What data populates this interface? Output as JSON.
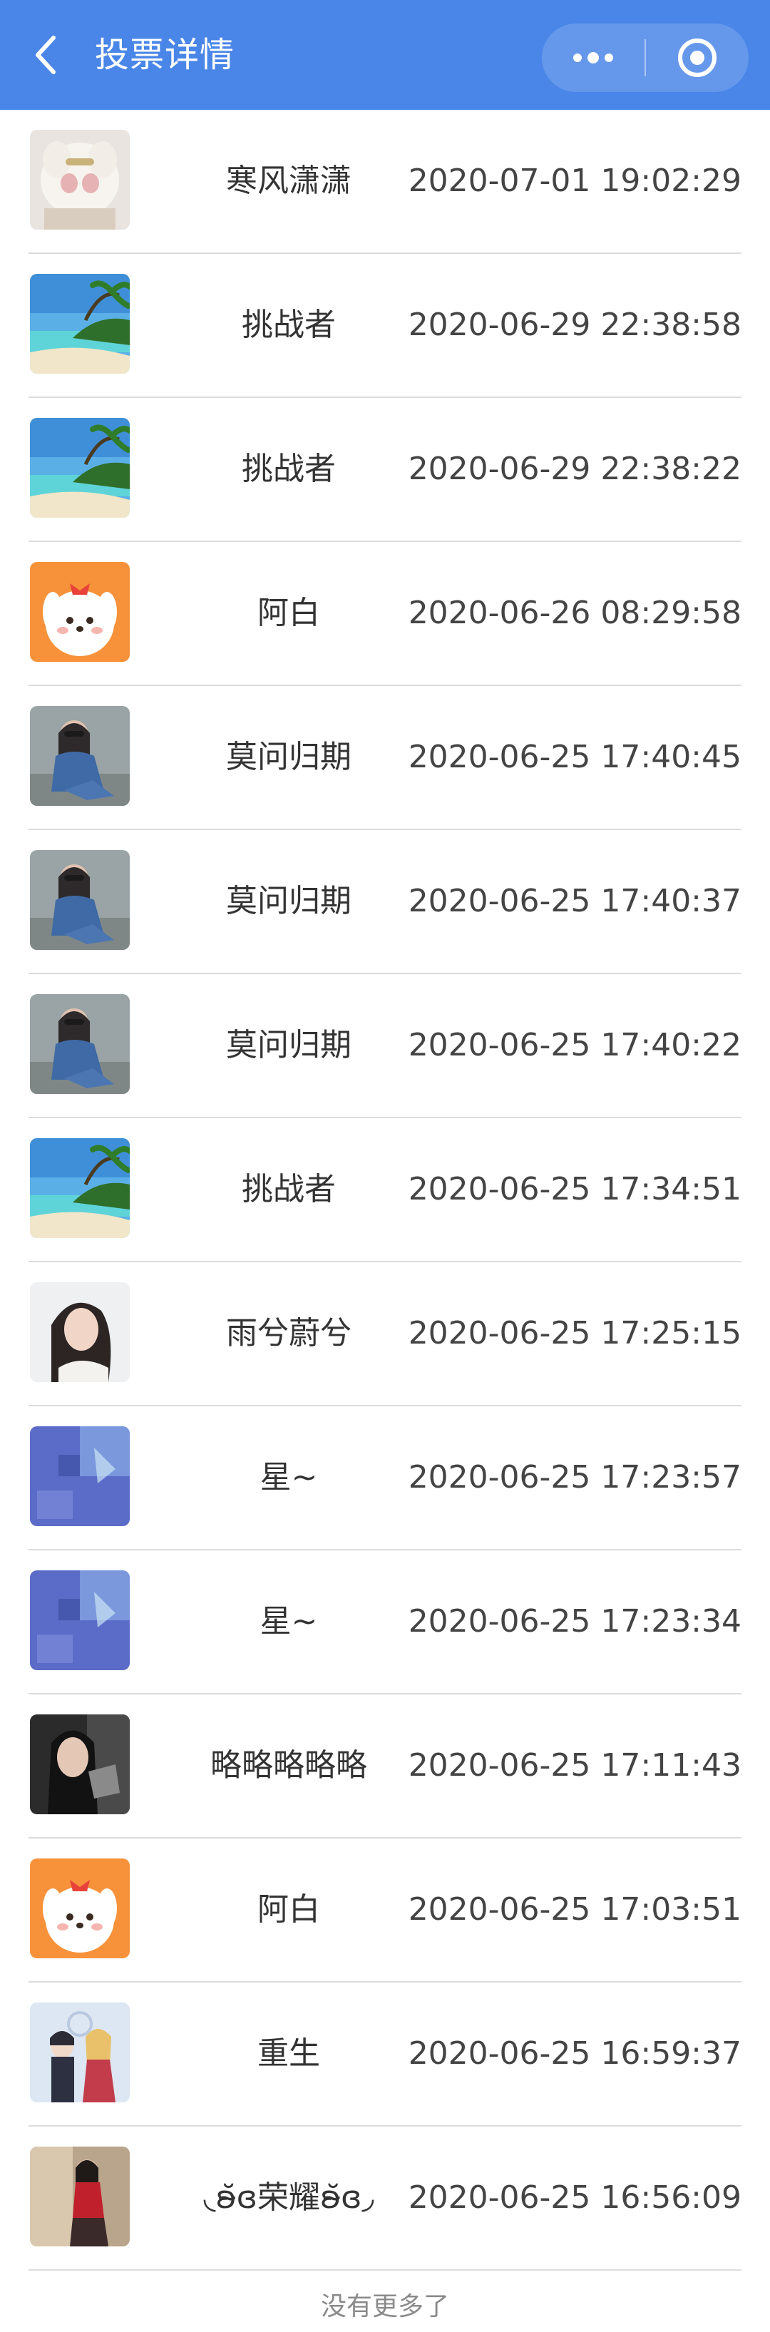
{
  "nav": {
    "title": "投票详情",
    "back_icon": "chevron-left-icon",
    "more_icon": "more-dots-icon",
    "close_icon": "target-circle-icon",
    "background": "#4a86e8"
  },
  "votes": [
    {
      "name": "寒风潇潇",
      "time": "2020-07-01 19:02:29",
      "avatar": "plush-toy"
    },
    {
      "name": "挑战者",
      "time": "2020-06-29 22:38:58",
      "avatar": "beach"
    },
    {
      "name": "挑战者",
      "time": "2020-06-29 22:38:22",
      "avatar": "beach"
    },
    {
      "name": "阿白",
      "time": "2020-06-26 08:29:58",
      "avatar": "cartoon-dog"
    },
    {
      "name": "莫问归期",
      "time": "2020-06-25 17:40:45",
      "avatar": "person-denim"
    },
    {
      "name": "莫问归期",
      "time": "2020-06-25 17:40:37",
      "avatar": "person-denim"
    },
    {
      "name": "莫问归期",
      "time": "2020-06-25 17:40:22",
      "avatar": "person-denim"
    },
    {
      "name": "挑战者",
      "time": "2020-06-25 17:34:51",
      "avatar": "beach"
    },
    {
      "name": "雨兮蔚兮",
      "time": "2020-06-25 17:25:15",
      "avatar": "portrait-woman"
    },
    {
      "name": "星~",
      "time": "2020-06-25 17:23:57",
      "avatar": "blue-abstract"
    },
    {
      "name": "星~",
      "time": "2020-06-25 17:23:34",
      "avatar": "blue-abstract"
    },
    {
      "name": "略略略略略",
      "time": "2020-06-25 17:11:43",
      "avatar": "dark-portrait"
    },
    {
      "name": "阿白",
      "time": "2020-06-25 17:03:51",
      "avatar": "cartoon-dog"
    },
    {
      "name": "重生",
      "time": "2020-06-25 16:59:37",
      "avatar": "anime-couple"
    },
    {
      "name": "◟ʚ̴̆ɞ荣耀ʚ̴̆ɞ◞",
      "time": "2020-06-25 16:56:09",
      "avatar": "person-red"
    }
  ],
  "footer": {
    "no_more": "没有更多了"
  }
}
